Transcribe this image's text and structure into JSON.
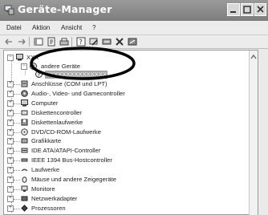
{
  "window": {
    "title": "Geräte-Manager"
  },
  "menu": {
    "items": [
      "Datei",
      "Aktion",
      "Ansicht",
      "?"
    ]
  },
  "tree": {
    "root": "XXX",
    "expanded": "andere Geräte",
    "child": "XXXXXXXXXXXXXXX",
    "items": [
      "Anschlüsse (COM und LPT)",
      "Audio-, Video- und Gamecontroller",
      "Computer",
      "Diskettencontroller",
      "Diskettenlaufwerke",
      "DVD/CD-ROM-Laufwerke",
      "Grafikkarte",
      "IDE ATA/ATAPI-Controller",
      "IEEE 1394 Bus-Hostcontroller",
      "Laufwerke",
      "Mäuse und andere Zeigegeräte",
      "Monitore",
      "Netzwerkadapter",
      "Prozessoren"
    ]
  }
}
